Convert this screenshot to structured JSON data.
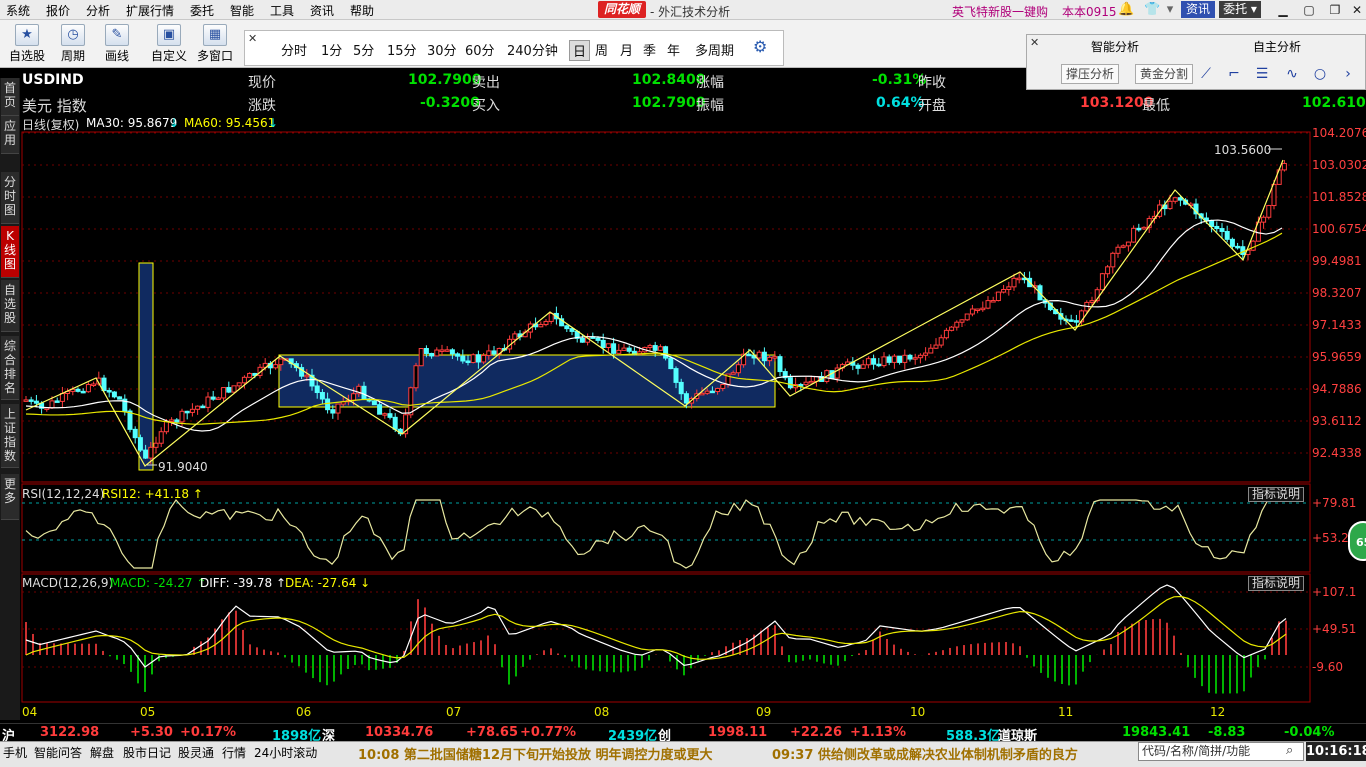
{
  "menubar": {
    "items": [
      "系统",
      "报价",
      "分析",
      "扩展行情",
      "委托",
      "智能",
      "工具",
      "资讯",
      "帮助"
    ],
    "logo": "同花顺",
    "title": "- 外汇技术分析",
    "promo": "英飞特新股一键购",
    "account": "本本0915",
    "news": "资讯",
    "trade": "委托 ▾"
  },
  "toolbar": {
    "tools": [
      {
        "icon": "★",
        "label": "自选股"
      },
      {
        "icon": "◷",
        "label": "周期"
      },
      {
        "icon": "✎",
        "label": "画线"
      },
      {
        "icon": "▣",
        "label": "自定义"
      },
      {
        "icon": "▦",
        "label": "多窗口"
      }
    ],
    "periods": [
      "分时",
      "1分",
      "5分",
      "15分",
      "30分",
      "60分",
      "240分钟",
      "日",
      "周",
      "月",
      "季",
      "年",
      "多周期"
    ],
    "active_period": "日"
  },
  "analysis": {
    "tab1": "智能分析",
    "tab2": "自主分析",
    "btn1": "撑压分析",
    "btn2": "黄金分割"
  },
  "side_tabs": [
    "首页",
    "应用",
    "分时图",
    "K线图",
    "自选股",
    "综合排名",
    "上证指数",
    "更多"
  ],
  "active_side_tab": "K线图",
  "quote": {
    "symbol": "USDIND",
    "name": "美元 指数",
    "current_label": "现价",
    "current": "102.7900",
    "sell_label": "卖出",
    "sell": "102.8400",
    "pct_label": "涨幅",
    "pct": "-0.31%",
    "prev_label": "昨收",
    "change_label": "涨跌",
    "change": "-0.3200",
    "buy_label": "买入",
    "buy": "102.7900",
    "amp_label": "振幅",
    "amp": "0.64%",
    "open_label": "开盘",
    "open": "103.1200",
    "low_label": "最低",
    "low": "102.6100"
  },
  "kline": {
    "label": "日线(复权)",
    "ma30": "MA30: 95.8679",
    "ma60": "MA60: 95.4561",
    "high_mark": "103.5600",
    "low_mark": "91.9040",
    "price_axis": [
      "104.2076",
      "103.0302",
      "101.8528",
      "100.6754",
      "99.4981",
      "98.3207",
      "97.1433",
      "95.9659",
      "94.7886",
      "93.6112",
      "92.4338"
    ],
    "months": [
      "04",
      "05",
      "06",
      "07",
      "08",
      "09",
      "10",
      "11",
      "12"
    ]
  },
  "rsi": {
    "label": "RSI(12,12,24)",
    "value": "RSI12: +41.18 ↑",
    "axis": [
      "+79.81",
      "+53.29"
    ],
    "explain": "指标说明"
  },
  "macd": {
    "label": "MACD(12,26,9)",
    "macd": "MACD: -24.27 ↑",
    "diff": "DIFF: -39.78 ↑",
    "dea": "DEA: -27.64 ↓",
    "axis": [
      "+107.1",
      "+49.51",
      "-9.60"
    ],
    "explain": "指标说明"
  },
  "badge": "65",
  "index_bar": {
    "sh": "沪",
    "sh_val": "3122.98",
    "sh_chg": "+5.30",
    "sh_pct": "+0.17%",
    "sh_amt": "1898亿",
    "sz": "深",
    "sz_val": "10334.76",
    "sz_chg": "+78.65",
    "sz_pct": "+0.77%",
    "sz_amt": "2439亿",
    "cy": "创",
    "cy_val": "1998.11",
    "cy_chg": "+22.26",
    "cy_pct": "+1.13%",
    "cy_amt": "588.3亿",
    "dj": "道琼斯",
    "dj_val": "19843.41",
    "dj_chg": "-8.83",
    "dj_pct": "-0.04%"
  },
  "statusbar": {
    "tabs": [
      "手机",
      "智能问答",
      "解盘",
      "股市日记",
      "股灵通",
      "行情",
      "24小时滚动"
    ],
    "news1": "10:08 第二批国储糖12月下旬开始投放 明年调控力度或更大",
    "news2": "09:37 供给侧改革或成解决农业体制机制矛盾的良方",
    "search": "代码/名称/简拼/功能",
    "time": "10:16:18"
  }
}
